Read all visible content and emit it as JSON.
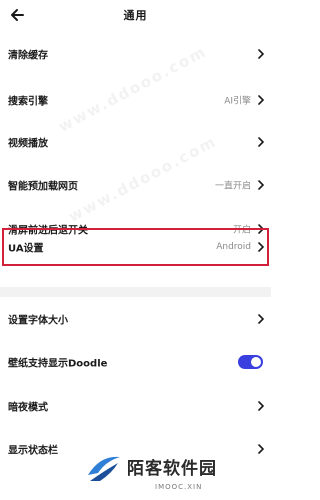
{
  "header": {
    "title": "通用",
    "back_icon": "back-arrow-icon"
  },
  "settings": [
    {
      "label": "清除缓存",
      "value": "",
      "control": "chevron"
    },
    {
      "label": "搜索引擎",
      "value": "AI引擎",
      "control": "chevron"
    },
    {
      "label": "视频播放",
      "value": "",
      "control": "chevron"
    },
    {
      "label": "智能预加载网页",
      "value": "一直开启",
      "control": "chevron"
    },
    {
      "label": "滑屏前进后退开关",
      "value": "开启",
      "control": "chevron"
    },
    {
      "label": "UA设置",
      "value": "Android",
      "control": "chevron",
      "highlighted": true
    },
    {
      "label": "设置字体大小",
      "value": "",
      "control": "chevron"
    },
    {
      "label": "壁纸支持显示Doodle",
      "value": "",
      "control": "toggle",
      "toggle_on": true
    },
    {
      "label": "暗夜模式",
      "value": "",
      "control": "chevron"
    },
    {
      "label": "显示状态栏",
      "value": "",
      "control": "chevron"
    }
  ],
  "colors": {
    "toggle_on": "#3a3fe0",
    "highlight_border": "#d3203a",
    "section_gap": "#f2f2f2"
  },
  "watermark": {
    "brand": "陌客软件园",
    "url": "IMOOC.XIN",
    "diagonal_text": "www.ddooo.com"
  }
}
